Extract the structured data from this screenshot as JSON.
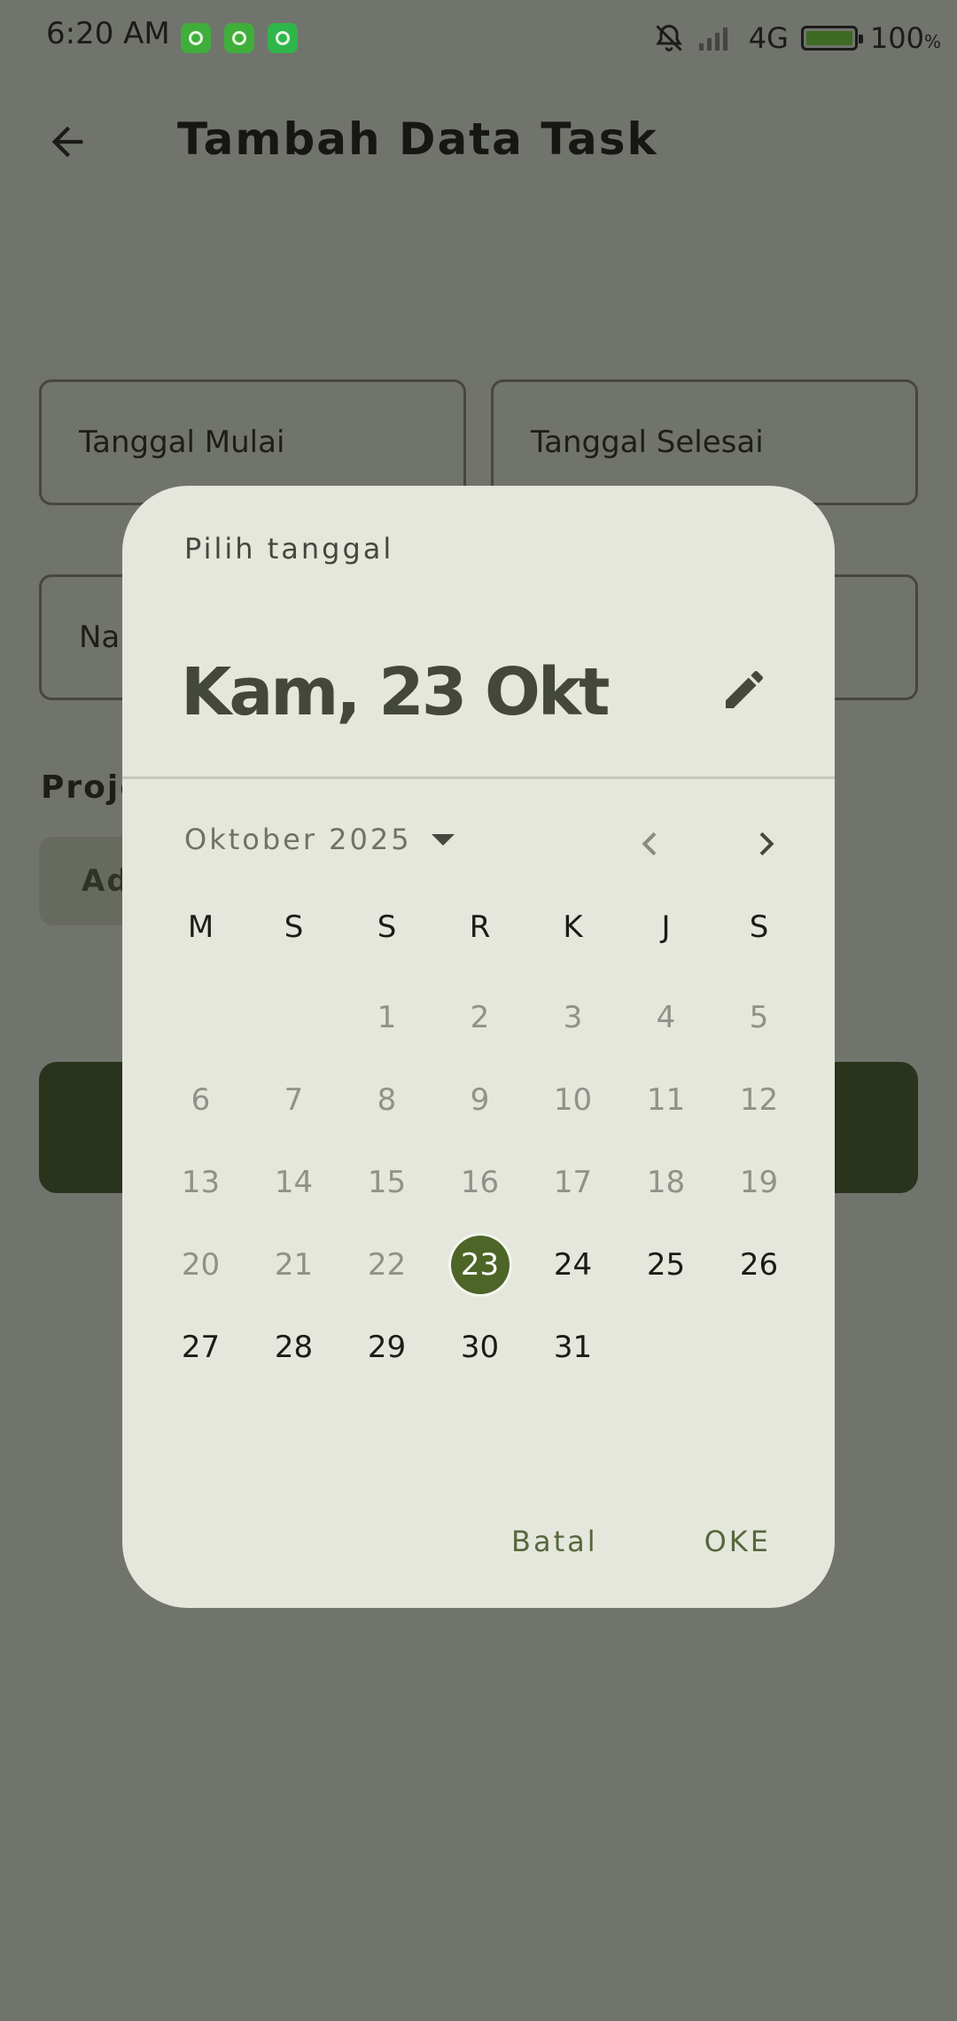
{
  "status_bar": {
    "time": "6:20 AM",
    "network": "4G",
    "battery": "100",
    "battery_unit": "%"
  },
  "app_bar": {
    "title": "Tambah Data Task"
  },
  "form": {
    "start_date_label": "Tanggal Mulai",
    "end_date_label": "Tanggal Selesai",
    "name_label_visible": "Na",
    "project_label_visible": "Proje",
    "add_chip_visible": "Ad"
  },
  "dialog": {
    "headline": "Pilih tanggal",
    "selected_date": "Kam, 23 Okt",
    "month_year": "Oktober 2025",
    "weekdays": [
      "M",
      "S",
      "S",
      "R",
      "K",
      "J",
      "S"
    ],
    "selected_day": "23",
    "cancel_label": "Batal",
    "ok_label": "OKE"
  },
  "colors": {
    "scrim": "#71736d",
    "dialog_bg": "#e5e7dc",
    "selected_day_bg": "#4d6527",
    "save_button": "#2a331b"
  }
}
